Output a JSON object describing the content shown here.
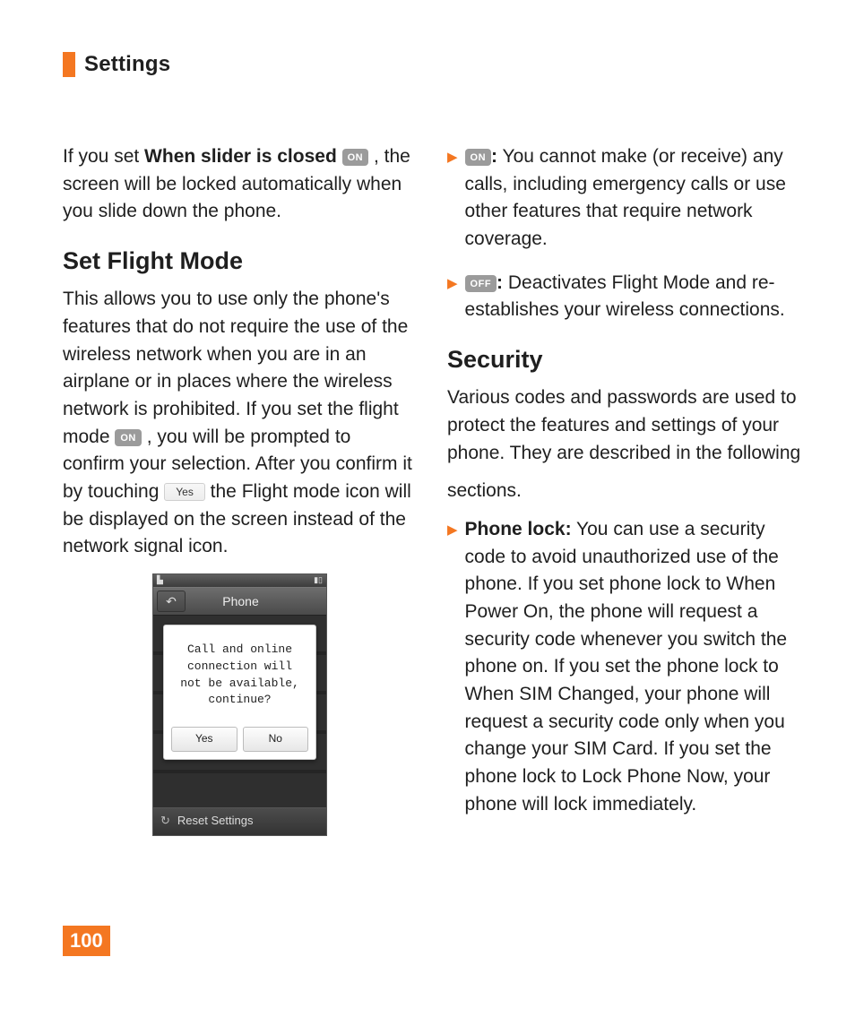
{
  "header": {
    "section": "Settings"
  },
  "page_number": "100",
  "left": {
    "intro": {
      "pre": "If you set ",
      "bold": "When slider is closed",
      "badge": "ON",
      "post": ", the screen will be locked automatically when you slide down the phone."
    },
    "h2": "Set Flight Mode",
    "flight": {
      "p1a": "This allows you to use only the phone's features that do not require the use of the wireless network when you are in an airplane or in places where the wireless network is prohibited. If you set the flight mode ",
      "badge": "ON",
      "p1b": ", you will be prompted to confirm your selection. After you confirm it by touching ",
      "yes_chip": "Yes",
      "p1c": " the Flight mode icon will be displayed on the screen instead of the network signal icon."
    }
  },
  "right": {
    "on": {
      "badge": "ON",
      "text": " You cannot make (or receive) any calls, including emergency calls or use other features that require network coverage."
    },
    "off": {
      "badge": "OFF",
      "text": " Deactivates Flight Mode and re-establishes your wireless connections."
    },
    "h2": "Security",
    "security_intro": "Various codes and passwords are used to protect the features and settings of your phone. They are described in the following",
    "sections_word": "sections.",
    "phone_lock": {
      "label": "Phone lock:",
      "text": " You can use a security code to avoid unauthorized use of the phone. If you set phone lock to When Power On, the phone will request a security code whenever you switch the phone on. If you set the phone lock to When SIM Changed, your phone will request a security code only when you change your SIM Card. If you set the phone lock to Lock Phone Now, your phone will lock immediately."
    }
  },
  "phone": {
    "title": "Phone",
    "dialog_line1": "Call and online",
    "dialog_line2": "connection will",
    "dialog_line3": "not be available,",
    "dialog_line4": "continue?",
    "btn_yes": "Yes",
    "btn_no": "No",
    "footer": "Reset Settings"
  }
}
